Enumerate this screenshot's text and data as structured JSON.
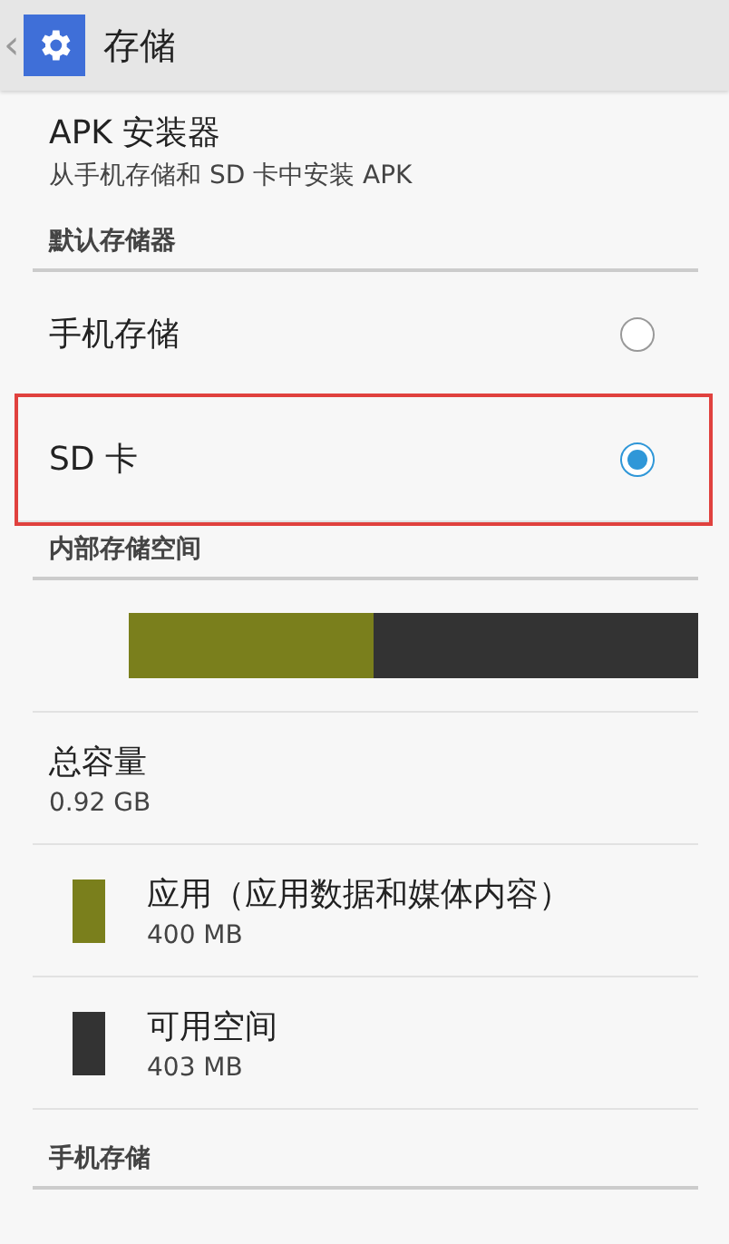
{
  "header": {
    "back": "‹",
    "title": "存储"
  },
  "apk": {
    "title": "APK 安装器",
    "subtitle": "从手机存储和 SD 卡中安装 APK"
  },
  "default_storage": {
    "heading": "默认存储器",
    "options": [
      {
        "label": "手机存储",
        "selected": false,
        "highlighted": false
      },
      {
        "label": "SD 卡",
        "selected": true,
        "highlighted": true
      }
    ]
  },
  "internal": {
    "heading": "内部存储空间",
    "bar": {
      "level": 0.43
    },
    "total": {
      "title": "总容量",
      "value": "0.92 GB"
    },
    "legend": [
      {
        "color": "#7a7f1c",
        "title": "应用（应用数据和媒体内容）",
        "value": "400 MB"
      },
      {
        "color": "#333333",
        "title": "可用空间",
        "value": "403 MB"
      }
    ]
  },
  "phone_storage": {
    "heading": "手机存储"
  }
}
